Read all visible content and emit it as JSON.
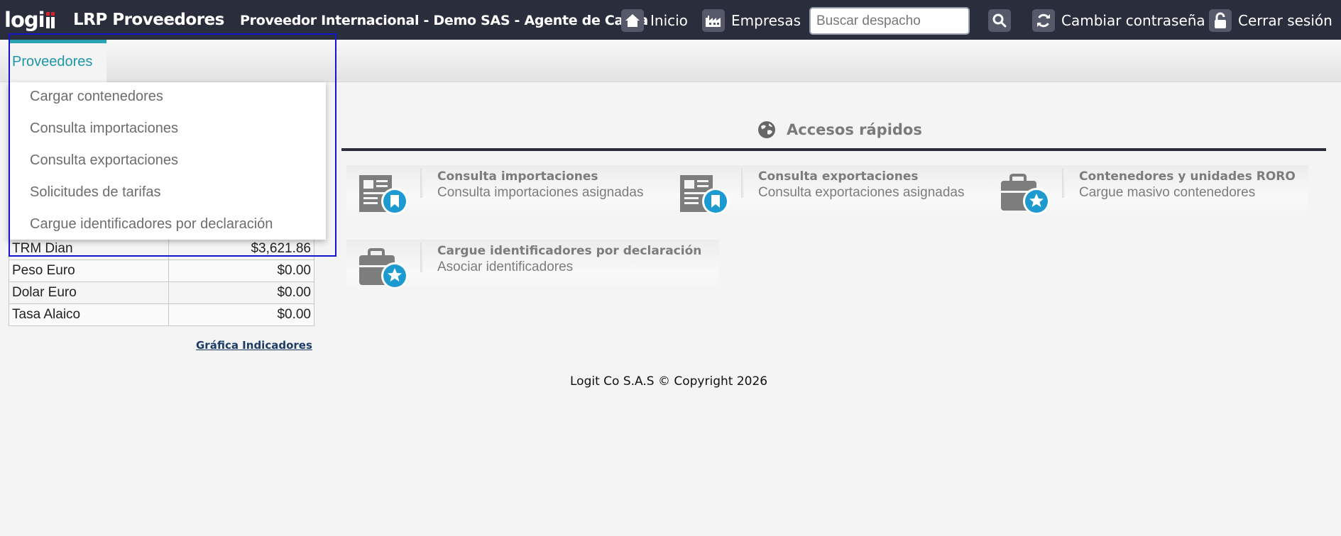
{
  "topbar": {
    "logo_text": "logi",
    "app_title": "LRP Proveedores",
    "company": "Proveedor Internacional - Demo SAS - Agente de Carga",
    "nav": {
      "home": "Inicio",
      "companies": "Empresas",
      "change_password": "Cambiar contraseña",
      "logout": "Cerrar sesión"
    },
    "search_placeholder": "Buscar despacho"
  },
  "menu": {
    "active_tab": "Proveedores",
    "dropdown_items": [
      "Cargar contenedores",
      "Consulta importaciones",
      "Consulta exportaciones",
      "Solicitudes de tarifas",
      "Cargue identificadores por declaración"
    ]
  },
  "indicators": {
    "rows": [
      {
        "label": "TRM Dian",
        "value": "$3,621.86"
      },
      {
        "label": "Peso Euro",
        "value": "$0.00"
      },
      {
        "label": "Dolar Euro",
        "value": "$0.00"
      },
      {
        "label": "Tasa Alaico",
        "value": "$0.00"
      }
    ],
    "graph_link": "Gráfica Indicadores"
  },
  "quick_access": {
    "title": "Accesos rápidos",
    "cards": [
      {
        "title": "Consulta importaciones",
        "subtitle": "Consulta importaciones asignadas",
        "icon": "document-bookmark-icon"
      },
      {
        "title": "Consulta exportaciones",
        "subtitle": "Consulta exportaciones asignadas",
        "icon": "document-bookmark-icon"
      },
      {
        "title": "Contenedores y unidades RORO",
        "subtitle": "Cargue masivo contenedores",
        "icon": "briefcase-star-icon"
      },
      {
        "title": "Cargue identificadores por declaración",
        "subtitle": "Asociar identificadores",
        "icon": "briefcase-star-icon"
      }
    ]
  },
  "footer": "Logit Co S.A.S © Copyright 2026",
  "colors": {
    "topbar_bg": "#2a2d3c",
    "accent_teal": "#2aa3b3",
    "badge_blue": "#1d9bd0",
    "logo_red": "#d8202f"
  }
}
